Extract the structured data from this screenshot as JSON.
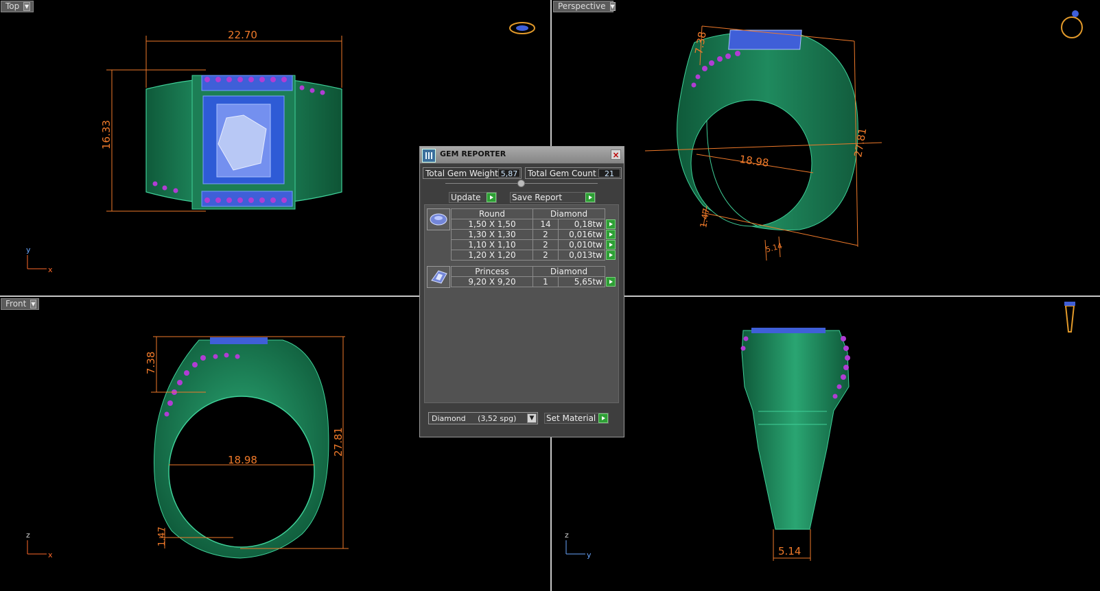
{
  "viewports": {
    "top": {
      "label": "Top",
      "dims": [
        "22.70",
        "16.33"
      ],
      "axes": [
        "y",
        "x"
      ]
    },
    "perspective": {
      "label": "Perspective",
      "dims": [
        "7.38",
        "18.98",
        "27.81",
        "1.47",
        "5.14"
      ]
    },
    "front": {
      "label": "Front",
      "dims": [
        "7.38",
        "18.98",
        "27.81",
        "1.47"
      ],
      "axes": [
        "z",
        "x"
      ]
    },
    "right": {
      "label": "",
      "dims": [
        "5.14"
      ],
      "axes": [
        "z",
        "y"
      ]
    }
  },
  "gem_reporter": {
    "title": "GEM REPORTER",
    "close": "×",
    "total_weight_label": "Total Gem Weight",
    "total_weight": "5,87",
    "total_count_label": "Total Gem Count",
    "total_count": "21",
    "update_label": "Update",
    "save_label": "Save Report",
    "groups": [
      {
        "shape": "Round",
        "material": "Diamond",
        "icon": "round-gem-icon",
        "rows": [
          {
            "size": "1,50 X 1,50",
            "count": "14",
            "weight": "0,18tw"
          },
          {
            "size": "1,30 X 1,30",
            "count": "2",
            "weight": "0,016tw"
          },
          {
            "size": "1,10 X 1,10",
            "count": "2",
            "weight": "0,010tw"
          },
          {
            "size": "1,20 X 1,20",
            "count": "2",
            "weight": "0,013tw"
          }
        ]
      },
      {
        "shape": "Princess",
        "material": "Diamond",
        "icon": "princess-gem-icon",
        "rows": [
          {
            "size": "9,20 X 9,20",
            "count": "1",
            "weight": "5,65tw"
          }
        ]
      }
    ],
    "material_select": "Diamond     (3,52 spg)",
    "set_material_label": "Set Material"
  },
  "colors": {
    "metal": "#1f8a5e",
    "metal_light": "#3cc08a",
    "gem_blue": "#4a6fe0",
    "gem_purple": "#a23dd0",
    "dimension": "#f07a2a"
  }
}
